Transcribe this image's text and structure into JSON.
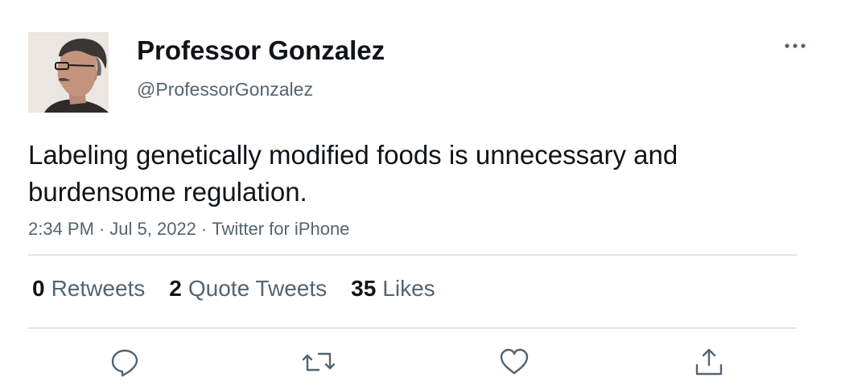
{
  "author": {
    "display_name": "Professor Gonzalez",
    "handle": "@ProfessorGonzalez"
  },
  "tweet": {
    "text": "Labeling genetically modified foods is unnecessary and burdensome regulation.",
    "time": "2:34 PM",
    "separator": "·",
    "date": "Jul 5, 2022",
    "source": "Twitter for iPhone"
  },
  "stats": {
    "retweets": {
      "count": "0",
      "label": "Retweets"
    },
    "quote_tweets": {
      "count": "2",
      "label": "Quote Tweets"
    },
    "likes": {
      "count": "35",
      "label": "Likes"
    }
  },
  "actions": [
    "reply-icon",
    "retweet-icon",
    "like-icon",
    "share-icon"
  ],
  "colors": {
    "text_primary": "#0f1419",
    "text_secondary": "#536471",
    "divider": "#e1e5e8"
  }
}
